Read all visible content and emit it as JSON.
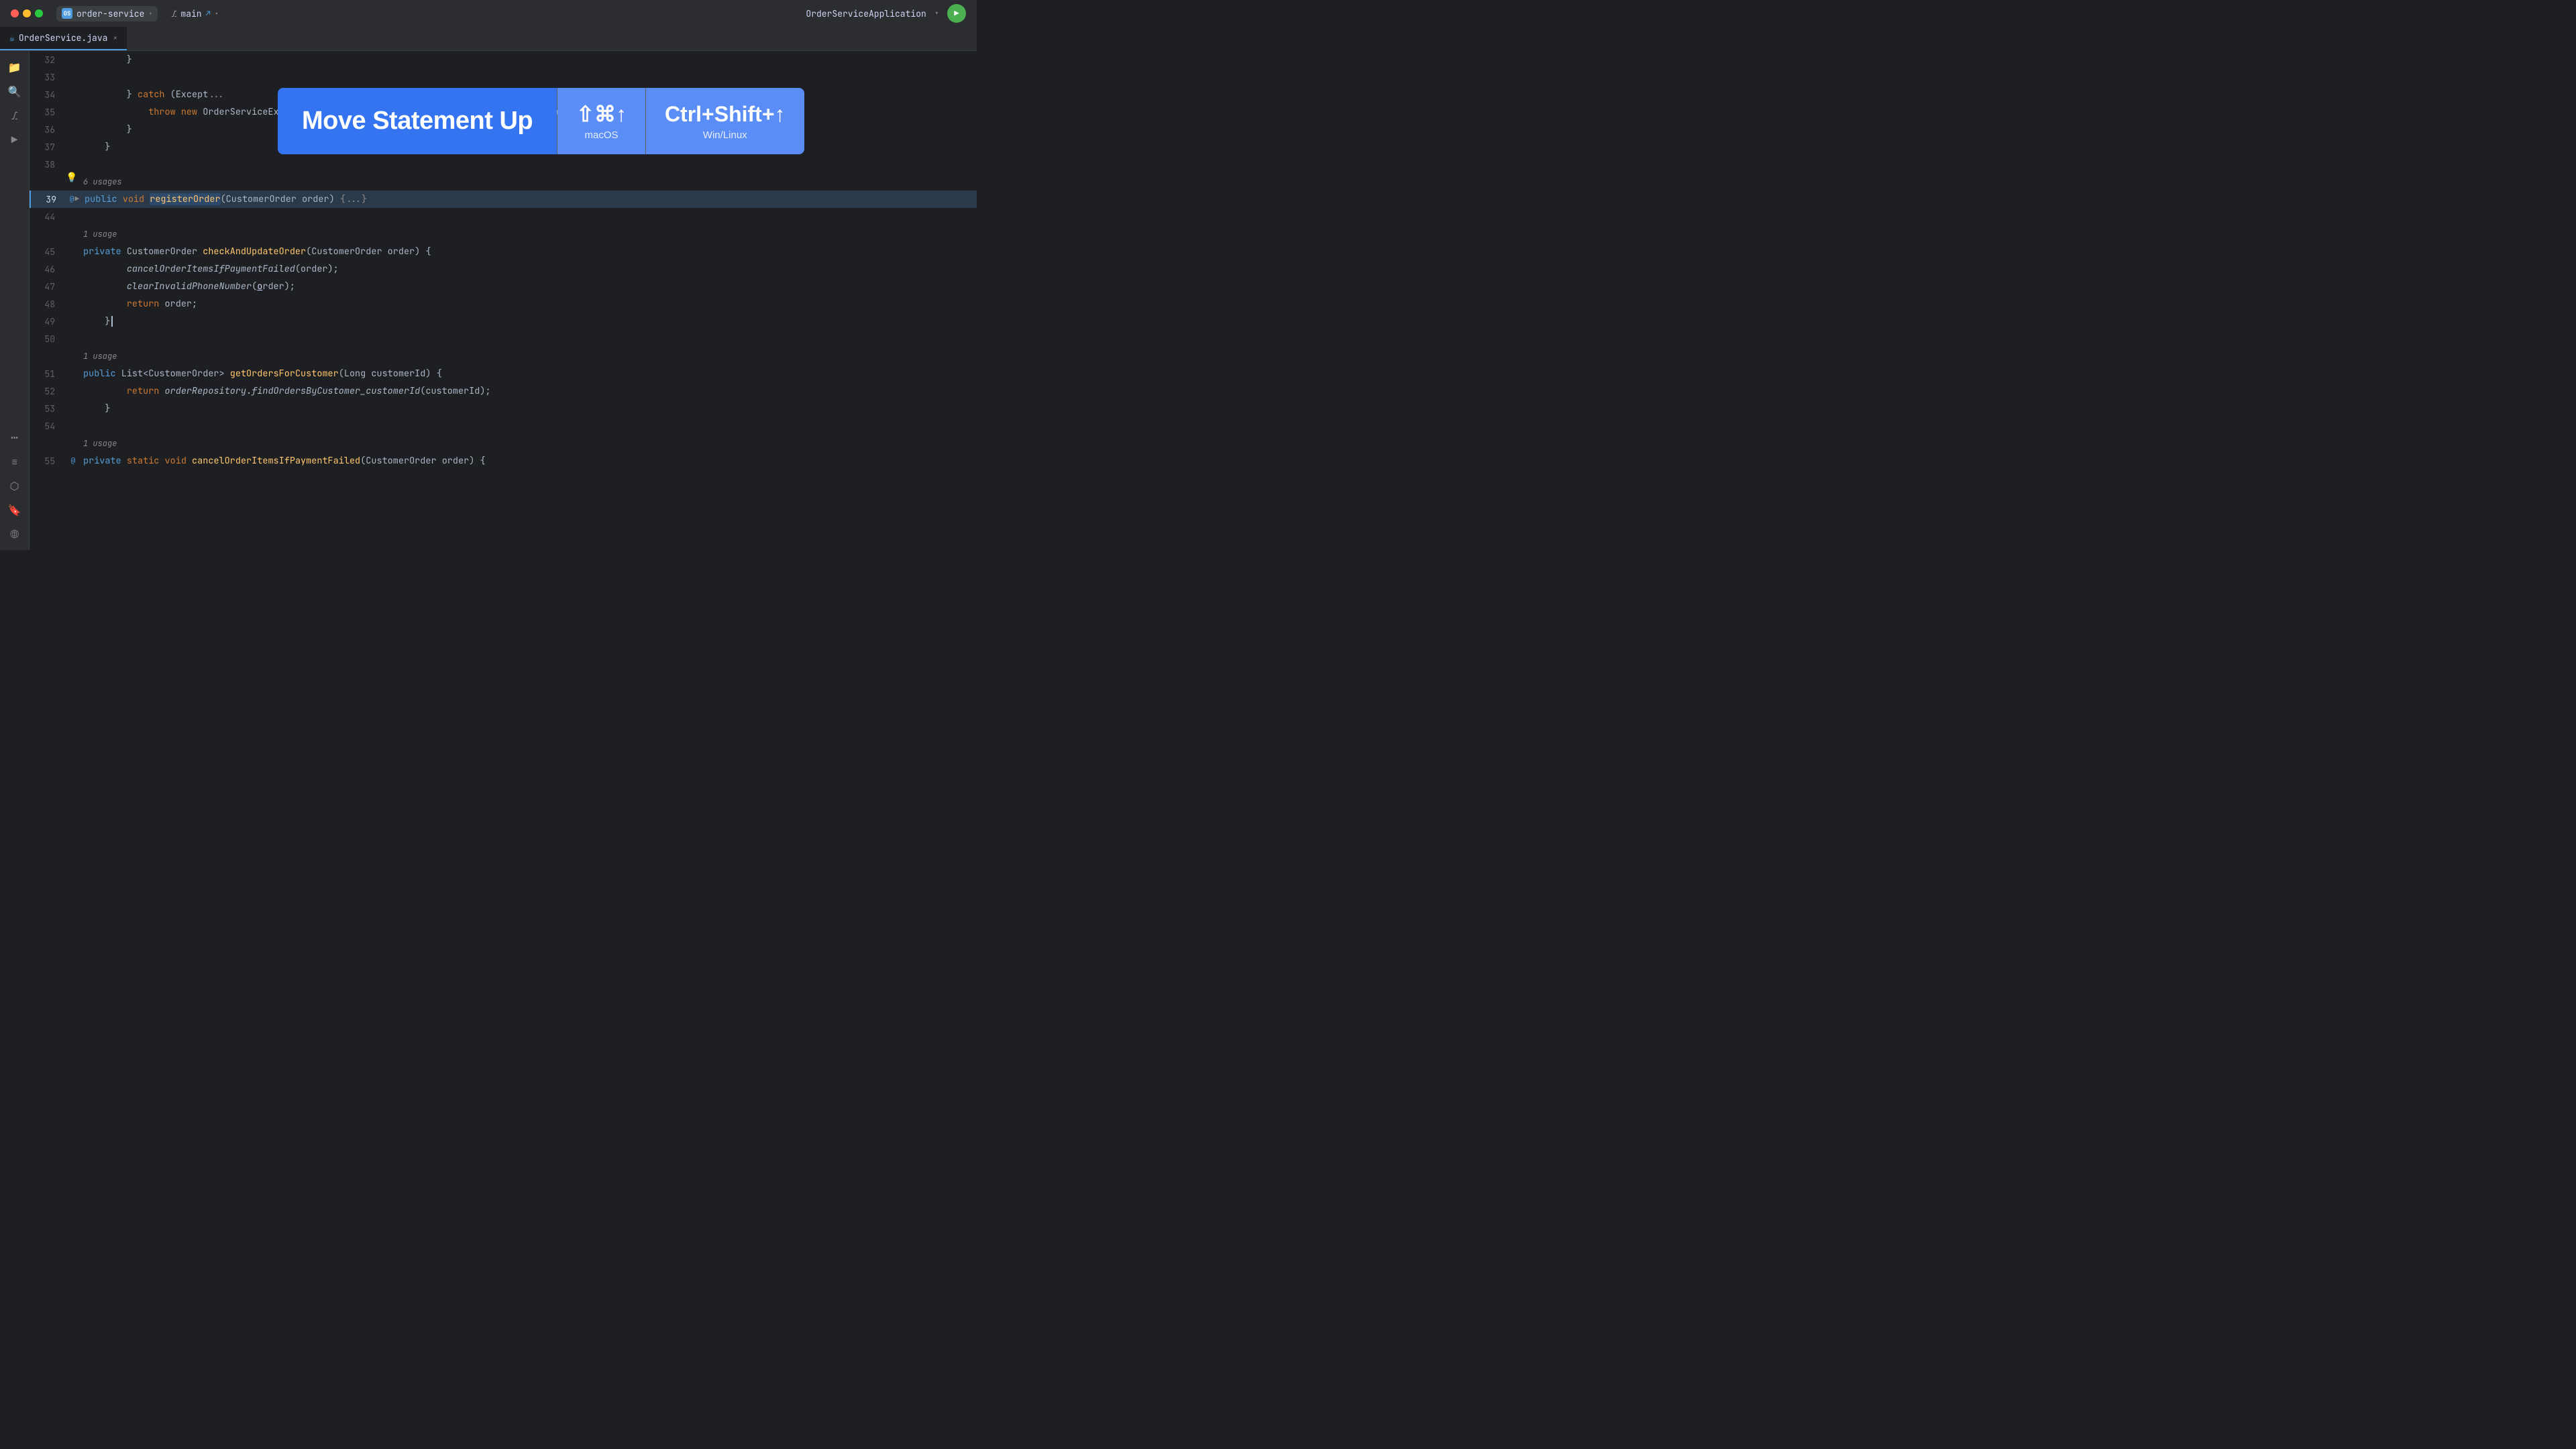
{
  "titlebar": {
    "project_icon": "OS",
    "project_name": "order-service",
    "branch_name": "main",
    "app_name": "OrderServiceApplication"
  },
  "tab": {
    "filename": "OrderService.java",
    "close": "×"
  },
  "tooltip": {
    "action": "Move Statement Up",
    "macos_keys": "⇧⌘↑",
    "macos_os": "macOS",
    "win_keys": "Ctrl+Shift+↑",
    "win_os": "Win/Linux"
  },
  "sidebar": {
    "icons": [
      {
        "name": "folder-icon",
        "symbol": "📁",
        "active": true
      },
      {
        "name": "magnify-icon",
        "symbol": "🔍"
      },
      {
        "name": "git-icon",
        "symbol": "⎇"
      },
      {
        "name": "run-debug-icon",
        "symbol": "▶"
      },
      {
        "name": "more-icon",
        "symbol": "···"
      }
    ]
  },
  "code": {
    "lines": [
      {
        "num": "32",
        "indent": 2,
        "content": "}",
        "type": "plain"
      },
      {
        "num": "33",
        "indent": 0,
        "content": "",
        "type": "empty"
      },
      {
        "num": "34",
        "indent": 1,
        "content": "} catch (Except...",
        "type": "catch"
      },
      {
        "num": "35",
        "indent": 2,
        "content": "throw new OrderServiceException(\"Error occurred while retrieving order by id\", e);",
        "type": "throw"
      },
      {
        "num": "36",
        "indent": 2,
        "content": "}",
        "type": "plain"
      },
      {
        "num": "37",
        "indent": 1,
        "content": "}",
        "type": "plain"
      },
      {
        "num": "38",
        "indent": 0,
        "content": "",
        "type": "empty"
      },
      {
        "num": "39",
        "indent": 0,
        "content": "public void registerOrder(CustomerOrder order) {...}",
        "type": "method",
        "usages": "6 usages",
        "has_indicator": true
      },
      {
        "num": "44",
        "indent": 0,
        "content": "",
        "type": "empty"
      },
      {
        "num": "45",
        "indent": 0,
        "content": "private CustomerOrder checkAndUpdateOrder(CustomerOrder order) {",
        "type": "method",
        "usages": "1 usage"
      },
      {
        "num": "46",
        "indent": 1,
        "content": "cancelOrderItemsIfPaymentFailed(order);",
        "type": "call"
      },
      {
        "num": "47",
        "indent": 1,
        "content": "clearInvalidPhoneNumber(order);",
        "type": "call"
      },
      {
        "num": "48",
        "indent": 1,
        "content": "return order;",
        "type": "return"
      },
      {
        "num": "49",
        "indent": 0,
        "content": "}",
        "type": "plain"
      },
      {
        "num": "50",
        "indent": 0,
        "content": "",
        "type": "empty"
      },
      {
        "num": "51",
        "indent": 0,
        "content": "public List<CustomerOrder> getOrdersForCustomer(Long customerId) {",
        "type": "method",
        "usages": "1 usage"
      },
      {
        "num": "52",
        "indent": 1,
        "content": "return orderRepository.findOrdersByCustomer_customerId(customerId);",
        "type": "return"
      },
      {
        "num": "53",
        "indent": 0,
        "content": "}",
        "type": "plain"
      },
      {
        "num": "54",
        "indent": 0,
        "content": "",
        "type": "empty"
      },
      {
        "num": "55",
        "indent": 0,
        "content": "private static void cancelOrderItemsIfPaymentFailed(CustomerOrder order) {",
        "type": "method",
        "usages": "1 usage"
      }
    ]
  }
}
